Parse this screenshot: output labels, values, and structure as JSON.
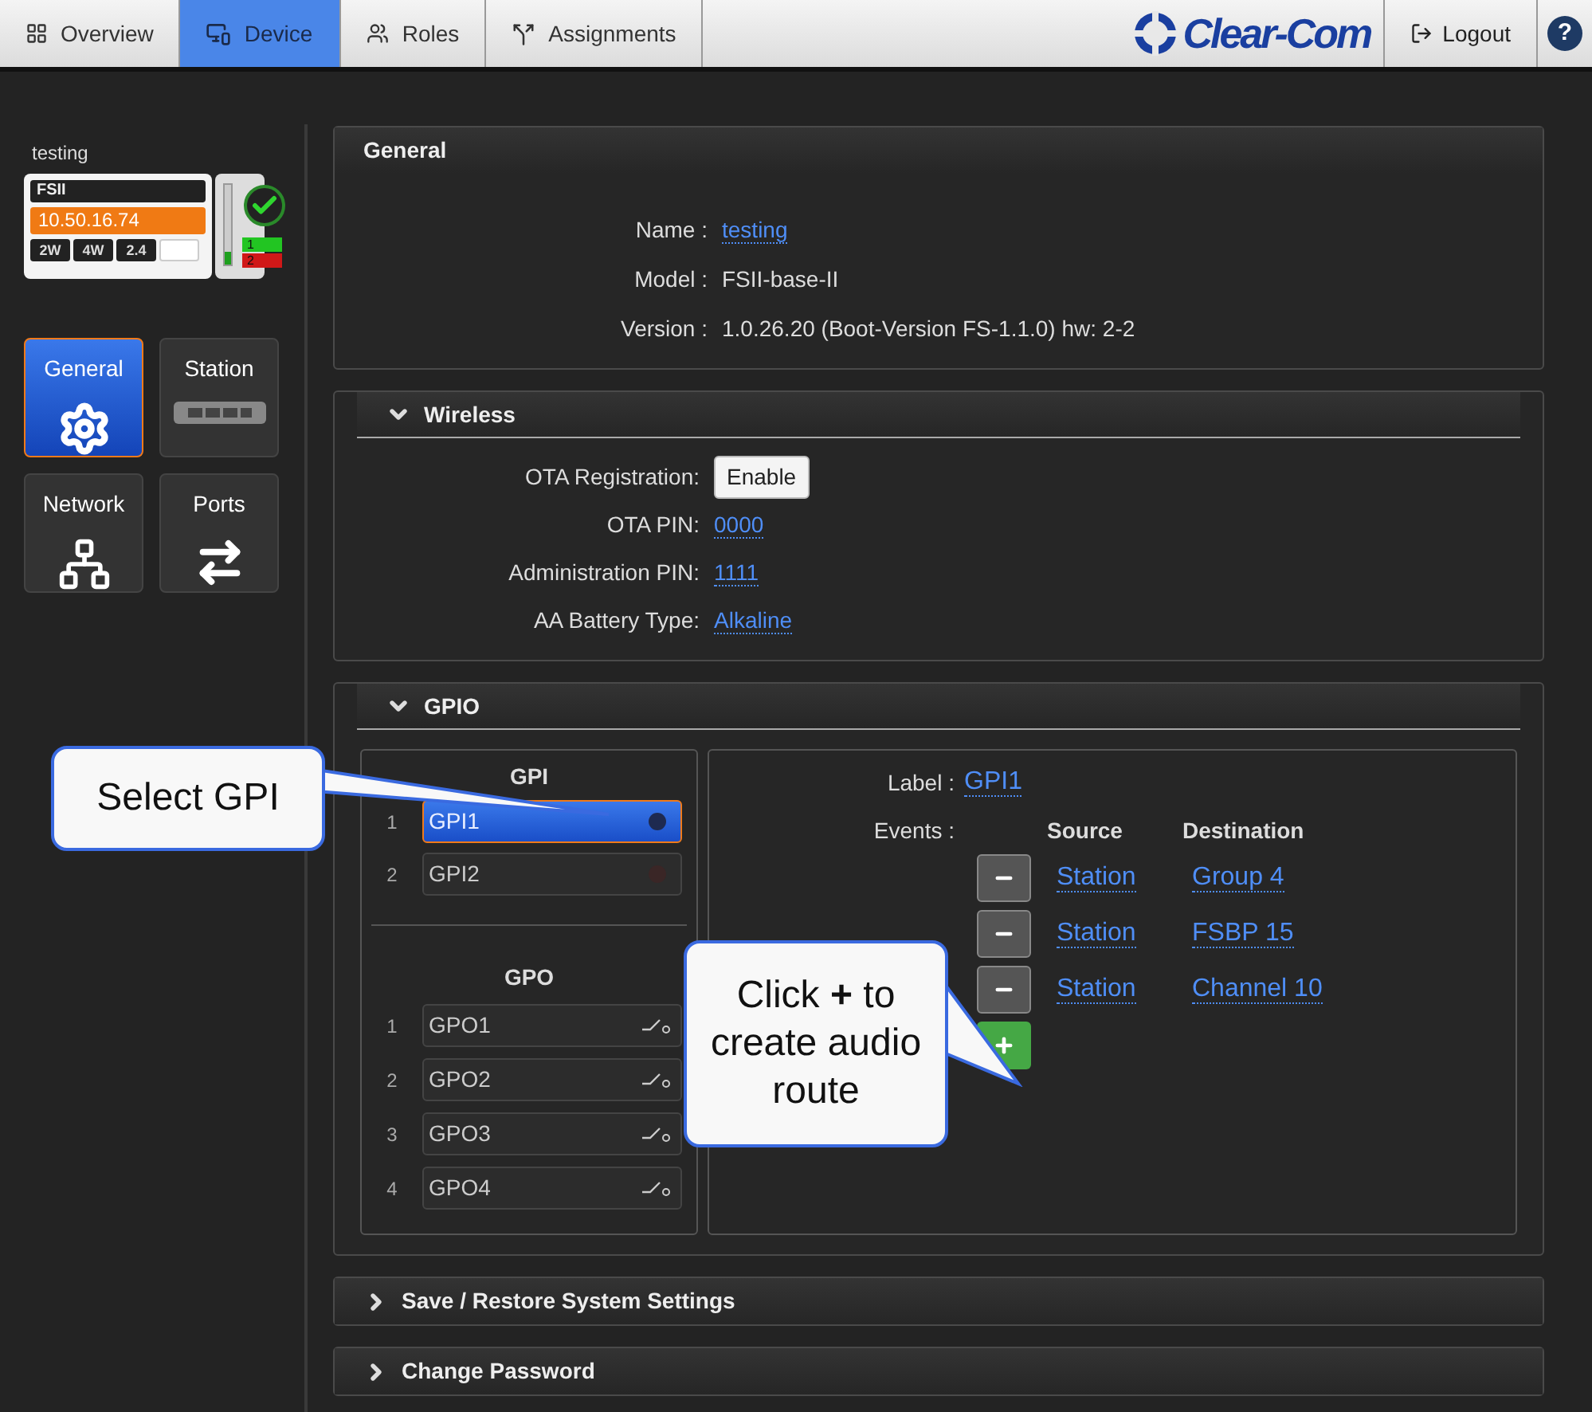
{
  "nav": {
    "tabs": [
      {
        "label": "Overview",
        "selected": false
      },
      {
        "label": "Device",
        "selected": true
      },
      {
        "label": "Roles",
        "selected": false
      },
      {
        "label": "Assignments",
        "selected": false
      }
    ],
    "brand": "Clear-Com",
    "logout": "Logout",
    "help": "?"
  },
  "device": {
    "name": "testing",
    "model": "FSII",
    "ip": "10.50.16.74",
    "badges": [
      "2W",
      "4W",
      "2.4"
    ],
    "ports": [
      {
        "label": "1",
        "color": "#22c522"
      },
      {
        "label": "2",
        "color": "#d01818"
      }
    ]
  },
  "side_tiles": [
    {
      "label": "General",
      "kind": "gear",
      "selected": true
    },
    {
      "label": "Station",
      "kind": "station",
      "selected": false
    },
    {
      "label": "Network",
      "kind": "network",
      "selected": false
    },
    {
      "label": "Ports",
      "kind": "ports",
      "selected": false
    }
  ],
  "sections": [
    {
      "title": "General",
      "kind": "plain",
      "fields": [
        {
          "label": "Name :",
          "value": "testing",
          "kind": "link"
        },
        {
          "label": "Model :",
          "value": "FSII-base-II",
          "kind": "text"
        },
        {
          "label": "Version :",
          "value": "1.0.26.20 (Boot-Version FS-1.1.0) hw: 2-2",
          "kind": "text"
        }
      ]
    },
    {
      "title": "Wireless",
      "kind": "panel",
      "expanded": true,
      "fields": [
        {
          "label": "OTA Registration:",
          "value": "Enable",
          "kind": "button"
        },
        {
          "label": "OTA PIN:",
          "value": "0000",
          "kind": "link"
        },
        {
          "label": "Administration PIN:",
          "value": "1111",
          "kind": "link"
        },
        {
          "label": "AA Battery Type:",
          "value": "Alkaline",
          "kind": "link"
        }
      ]
    },
    {
      "title": "GPIO",
      "kind": "gpio",
      "expanded": true
    },
    {
      "title": "Save / Restore System Settings",
      "kind": "panel",
      "expanded": false
    },
    {
      "title": "Change Password",
      "kind": "panel",
      "expanded": false
    }
  ],
  "gpio": {
    "gpi_title": "GPI",
    "gpi": [
      {
        "index": "1",
        "label": "GPI1",
        "selected": true
      },
      {
        "index": "2",
        "label": "GPI2",
        "selected": false
      }
    ],
    "gpo_title": "GPO",
    "gpo": [
      {
        "index": "1",
        "label": "GPO1"
      },
      {
        "index": "2",
        "label": "GPO2"
      },
      {
        "index": "3",
        "label": "GPO3"
      },
      {
        "index": "4",
        "label": "GPO4"
      }
    ],
    "label_caption": "Label :",
    "label_value": "GPI1",
    "events_caption": "Events :",
    "source_header": "Source",
    "destination_header": "Destination",
    "events": [
      {
        "source": "Station",
        "destination": "Group 4"
      },
      {
        "source": "Station",
        "destination": "FSBP 15"
      },
      {
        "source": "Station",
        "destination": "Channel 10"
      }
    ]
  },
  "callouts": [
    {
      "text": "Select GPI"
    },
    {
      "text": "Click **+** to create audio route"
    }
  ]
}
